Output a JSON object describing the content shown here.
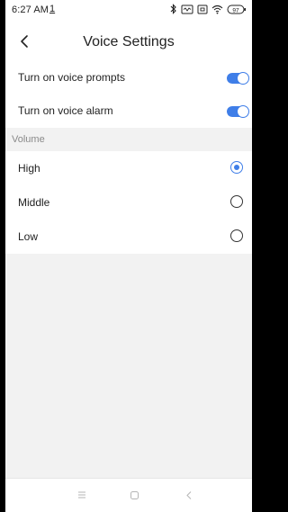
{
  "status_bar": {
    "time": "6:27 AM",
    "alert_glyph": "1",
    "icons": [
      "bluetooth-icon",
      "vibrate-icon",
      "sim-icon",
      "wifi-icon",
      "battery-icon"
    ],
    "battery_level": "97"
  },
  "header": {
    "title": "Voice Settings",
    "back_icon": "chevron-left-icon"
  },
  "toggles": [
    {
      "label": "Turn on voice prompts",
      "enabled": true
    },
    {
      "label": "Turn on voice alarm",
      "enabled": true
    }
  ],
  "volume": {
    "section_label": "Volume",
    "options": [
      {
        "label": "High",
        "selected": true
      },
      {
        "label": "Middle",
        "selected": false
      },
      {
        "label": "Low",
        "selected": false
      }
    ]
  },
  "nav_bar": {
    "icons": [
      "menu-icon",
      "home-icon",
      "back-icon"
    ]
  },
  "colors": {
    "accent": "#3f7ee8",
    "background": "#f2f2f2",
    "surface": "#ffffff",
    "text": "#222222",
    "secondary_text": "#8a8a8a"
  }
}
